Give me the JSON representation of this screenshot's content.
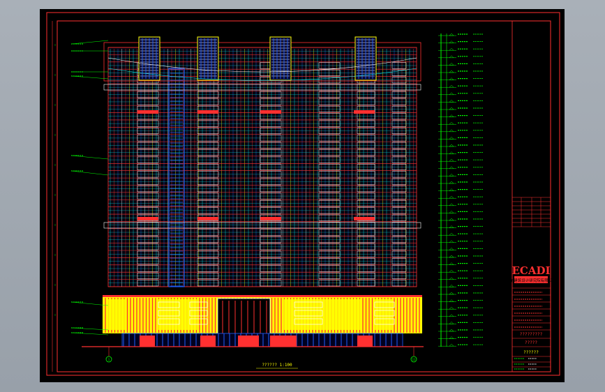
{
  "drawing": {
    "title": "?????? 1:100",
    "logo": "ECADI",
    "logo_subtitle": "华东建筑设计研究院有限公司",
    "project_label": "?????????",
    "drawing_name": "?????",
    "sheet_name": "??????",
    "left_axis_marker": "1",
    "right_axis_marker": "11"
  },
  "colors": {
    "background": "#000000",
    "frame": "#ff3030",
    "green": "#00ff00",
    "yellow": "#ffff00",
    "blue": "#2060ff",
    "white": "#ffffff",
    "cyan": "#00ffff"
  },
  "building": {
    "tower_floors": 33,
    "penthouse_blocks": 4,
    "podium_floors": 2
  }
}
